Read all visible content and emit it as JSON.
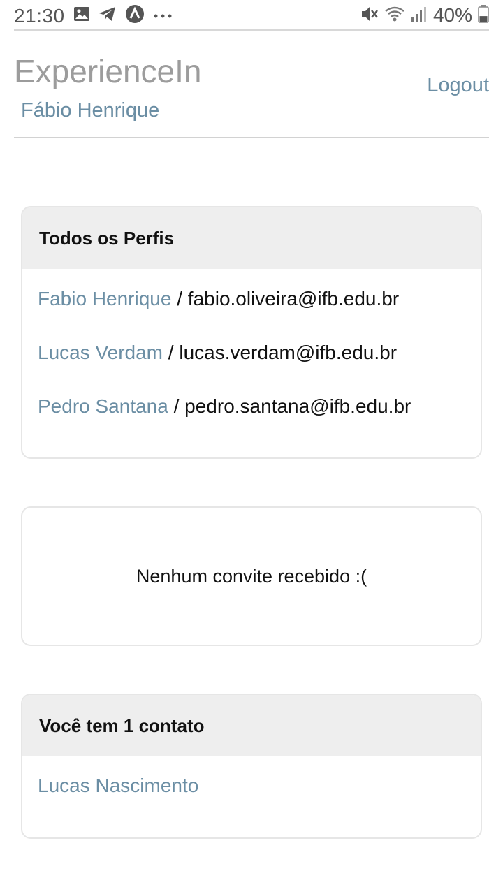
{
  "status_bar": {
    "time": "21:30",
    "left_icons": [
      "image-icon",
      "telegram-icon",
      "app-notification-icon",
      "more-notifications-icon"
    ],
    "right_icons": [
      "mute-icon",
      "wifi-icon",
      "signal-icon"
    ],
    "battery_text": "40%",
    "battery_level": 0.4
  },
  "header": {
    "app_title": "ExperienceIn",
    "user_name": "Fábio Henrique",
    "logout_label": "Logout"
  },
  "profiles_card": {
    "title": "Todos os Perfis",
    "separator": " / ",
    "items": [
      {
        "name": "Fabio Henrique",
        "email": "fabio.oliveira@ifb.edu.br"
      },
      {
        "name": "Lucas Verdam",
        "email": "lucas.verdam@ifb.edu.br"
      },
      {
        "name": "Pedro Santana",
        "email": "pedro.santana@ifb.edu.br"
      }
    ]
  },
  "invites_card": {
    "empty_message": "Nenhum convite recebido :("
  },
  "contacts_card": {
    "title": "Você tem 1 contato",
    "items": [
      {
        "name": "Lucas Nascimento"
      }
    ]
  },
  "colors": {
    "link": "#6b8ea4",
    "title_gray": "#9c9c9c",
    "card_header_bg": "#eeeeee",
    "card_border": "#e6e6e6"
  }
}
